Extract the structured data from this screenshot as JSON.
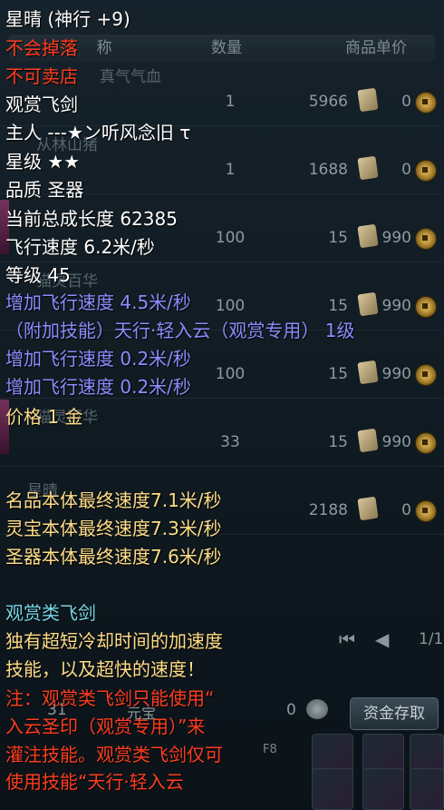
{
  "shop": {
    "headers": {
      "name": "称",
      "qty": "数量",
      "unit_price": "商品单价"
    },
    "rows": [
      {
        "name": "真气气血",
        "qty": "1",
        "price": "5966",
        "coin": "0"
      },
      {
        "name": "从林山猪",
        "qty": "1",
        "price": "1688",
        "coin": "0"
      },
      {
        "name": "",
        "qty": "100",
        "price": "15",
        "coin": "990"
      },
      {
        "name": "猫灵百华",
        "qty": "100",
        "price": "15",
        "coin": "990"
      },
      {
        "name": "",
        "qty": "100",
        "price": "15",
        "coin": "990"
      },
      {
        "name": "猫灵百华",
        "qty": "33",
        "price": "15",
        "coin": "990"
      },
      {
        "name": "星晴",
        "qty": "",
        "price": "2188",
        "coin": "0"
      }
    ],
    "pager": {
      "page": "1/1"
    },
    "bottom": {
      "left_num": "31",
      "currency_label": "元宝",
      "zero": "0",
      "deposit_label": "资金存取",
      "slot_hint": "F8"
    }
  },
  "tooltip": {
    "title": "星晴 (神行 +9)",
    "no_drop": "不会掉落",
    "no_sell": "不可卖店",
    "category": "观赏飞剑",
    "owner": "主人 ---★ン听风念旧 τ",
    "star_level": "星级 ★★",
    "quality": "品质 圣器",
    "growth": "当前总成长度 62385",
    "flight_speed": "飞行速度 6.2米/秒",
    "level": "等级 45",
    "bonus_speed_1": "增加飞行速度 4.5米/秒",
    "skill": "（附加技能）天行·轻入云（观赏专用） 1级",
    "bonus_speed_2": "增加飞行速度 0.2米/秒",
    "bonus_speed_3": "增加飞行速度 0.2米/秒",
    "price": "价格 1 金",
    "final_speeds": [
      "名品本体最终速度7.1米/秒",
      "灵宝本体最终速度7.3米/秒",
      "圣器本体最终速度7.6米/秒"
    ],
    "type_header": "观赏类飞剑",
    "desc_lines": [
      "独有超短冷却时间的加速度",
      "技能，以及超快的速度！"
    ],
    "note_lines": [
      "注：观赏类飞剑只能使用“",
      "入云圣印（观赏专用）”来",
      "灌注技能。观赏类飞剑仅可",
      "使用技能“天行·轻入云"
    ]
  }
}
